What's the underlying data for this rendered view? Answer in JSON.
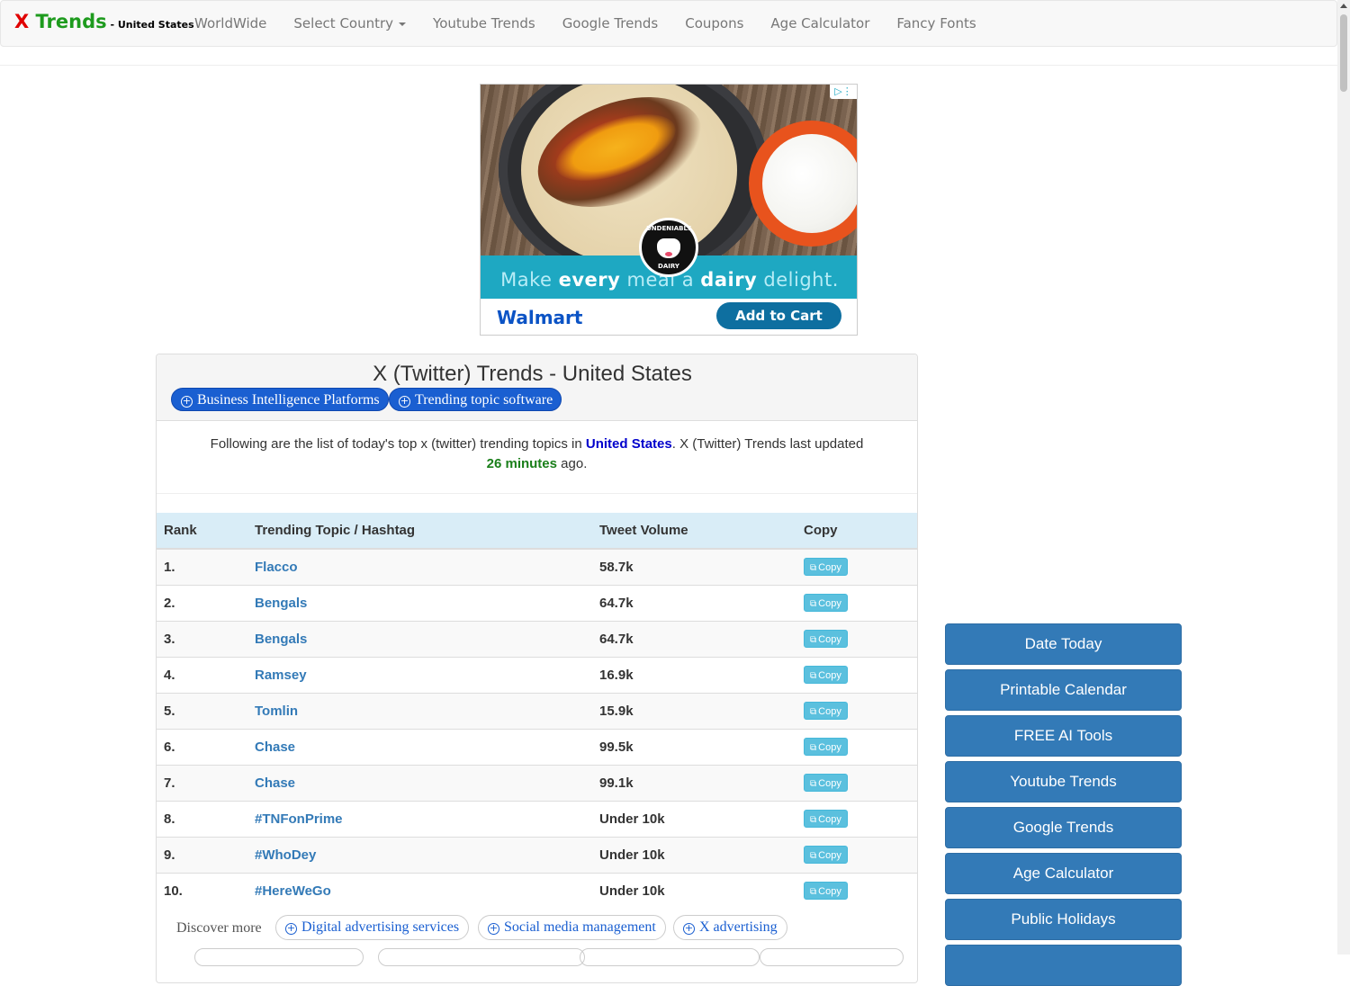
{
  "navbar": {
    "brand_x": "X",
    "brand_trends": " Trends",
    "brand_sub": " - United States",
    "links": [
      "WorldWide",
      "Select Country",
      "Youtube Trends",
      "Google Trends",
      "Coupons",
      "Age Calculator",
      "Fancy Fonts"
    ]
  },
  "ad": {
    "slogan_1": "Make ",
    "slogan_2": "every",
    "slogan_3": " meal a ",
    "slogan_4": "dairy",
    "slogan_5": " delight.",
    "brand": "Walmart",
    "cta": "Add to Cart",
    "logo_top": "UNDENIABLY",
    "logo_bottom": "DAIRY"
  },
  "panel": {
    "title": "X (Twitter) Trends - United States",
    "pills": [
      "Business Intelligence Platforms",
      "Trending topic software"
    ],
    "intro_before": "Following are the list of today's top x (twitter) trending topics in ",
    "intro_country": "United States",
    "intro_middle": ". X (Twitter) Trends last updated ",
    "intro_minutes": "26 minutes",
    "intro_after": " ago."
  },
  "table": {
    "headers": [
      "Rank",
      "Trending Topic / Hashtag",
      "Tweet Volume",
      "Copy"
    ],
    "copy_label": "Copy",
    "rows": [
      {
        "rank": "1.",
        "topic": "Flacco",
        "volume": "58.7k"
      },
      {
        "rank": "2.",
        "topic": "Bengals",
        "volume": "64.7k"
      },
      {
        "rank": "3.",
        "topic": "Bengals",
        "volume": "64.7k"
      },
      {
        "rank": "4.",
        "topic": "Ramsey",
        "volume": "16.9k"
      },
      {
        "rank": "5.",
        "topic": "Tomlin",
        "volume": "15.9k"
      },
      {
        "rank": "6.",
        "topic": "Chase",
        "volume": "99.5k"
      },
      {
        "rank": "7.",
        "topic": "Chase",
        "volume": "99.1k"
      },
      {
        "rank": "8.",
        "topic": "#TNFonPrime",
        "volume": "Under 10k"
      },
      {
        "rank": "9.",
        "topic": "#WhoDey",
        "volume": "Under 10k"
      },
      {
        "rank": "10.",
        "topic": "#HereWeGo",
        "volume": "Under 10k"
      }
    ]
  },
  "discover": {
    "label": "Discover more",
    "pills": [
      "Digital advertising services",
      "Social media management",
      "X advertising"
    ]
  },
  "sidebar": {
    "buttons": [
      "Date Today",
      "Printable Calendar",
      "FREE AI Tools",
      "Youtube Trends",
      "Google Trends",
      "Age Calculator",
      "Public Holidays"
    ]
  },
  "colors": {
    "brand_red": "#e00000",
    "brand_green": "#1e9b1e",
    "link_blue": "#337ab7",
    "pill_blue": "#1a5fd1",
    "table_header": "#d9edf7",
    "copy_button": "#5bc0de",
    "sidebar_button": "#337ab7"
  }
}
